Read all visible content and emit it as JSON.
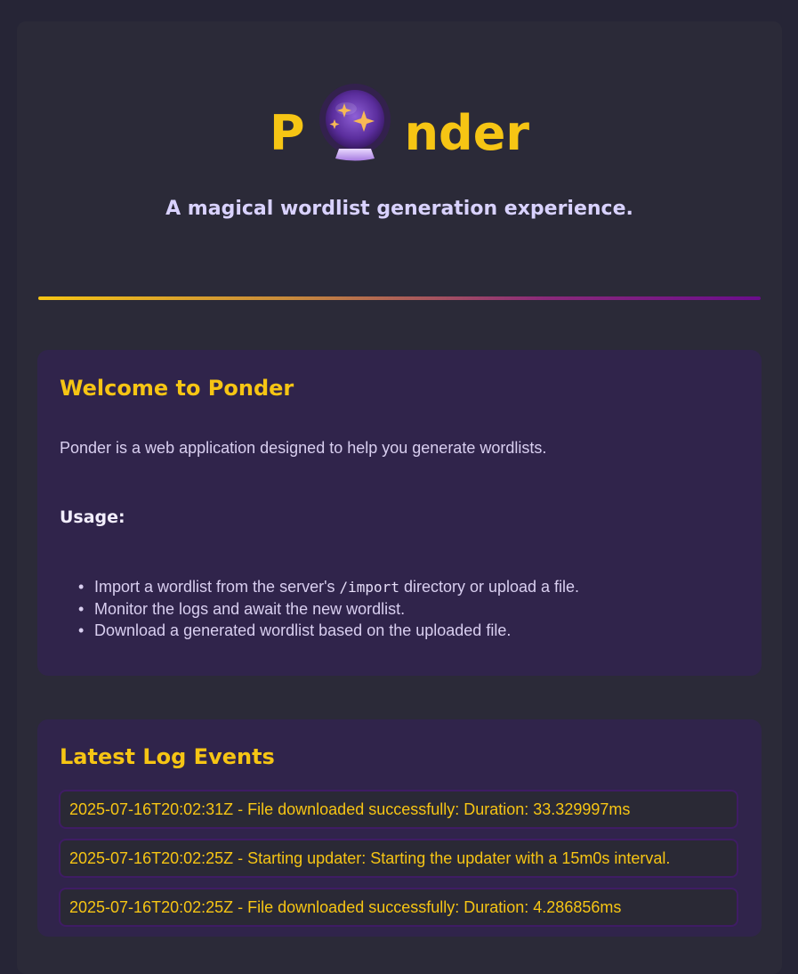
{
  "brand": {
    "letter_left": "P",
    "letters_right": "nder",
    "logo_icon": "crystal-ball-icon",
    "color": "#f6c514"
  },
  "tagline": "A magical wordlist generation experience.",
  "welcome": {
    "title": "Welcome to Ponder",
    "intro": "Ponder is a web application designed to help you generate wordlists.",
    "usage_heading": "Usage:",
    "steps": [
      {
        "before": "Import a wordlist from the server's ",
        "code": "/import",
        "after": " directory or upload a file."
      },
      {
        "before": "Monitor the logs and await the new wordlist.",
        "code": "",
        "after": ""
      },
      {
        "before": "Download a generated wordlist based on the uploaded file.",
        "code": "",
        "after": ""
      }
    ]
  },
  "logs": {
    "title": "Latest Log Events",
    "events": [
      "2025-07-16T20:02:31Z - File downloaded successfully: Duration: 33.329997ms",
      "2025-07-16T20:02:25Z - Starting updater: Starting the updater with a 15m0s interval.",
      "2025-07-16T20:02:25Z - File downloaded successfully: Duration: 4.286856ms"
    ]
  },
  "colors": {
    "background": "#262536",
    "panel": "#2b2a38",
    "card": "#30244b",
    "accent": "#f6c514",
    "divider_end": "#6a0d8c"
  }
}
